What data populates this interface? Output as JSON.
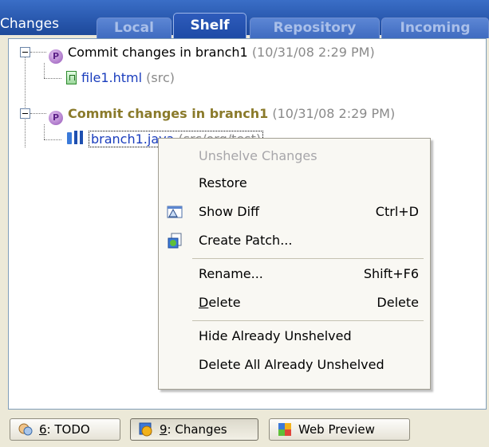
{
  "tabs": {
    "title": "Changes",
    "items": [
      {
        "label": "Local"
      },
      {
        "label": "Shelf"
      },
      {
        "label": "Repository"
      },
      {
        "label": "Incoming"
      }
    ]
  },
  "tree": {
    "list1": {
      "title": "Commit changes in branch1",
      "date": "(10/31/08 2:29 PM)"
    },
    "file1": {
      "name": "file1.html",
      "dir": "(src)"
    },
    "list2": {
      "title": "Commit changes in branch1",
      "date": "(10/31/08 2:29 PM)"
    },
    "file2": {
      "name": "branch1.java",
      "dir": "(src/org/test)"
    }
  },
  "menu": {
    "unshelve": "Unshelve Changes",
    "restore": "Restore",
    "show_diff": "Show Diff",
    "show_diff_key": "Ctrl+D",
    "create_patch": "Create Patch...",
    "rename": "Rename...",
    "rename_key": "Shift+F6",
    "delete_mn": "D",
    "delete_rest": "elete",
    "delete_key": "Delete",
    "hide_unshelved": "Hide Already Unshelved",
    "delete_all_unshelved": "Delete All Already Unshelved"
  },
  "toolbar": {
    "todo_mn": "6",
    "todo_rest": ": TODO",
    "changes_mn": "9",
    "changes_rest": ": Changes",
    "web_preview": "Web Preview"
  },
  "colors": {
    "tab_bar": "#2553a8",
    "selection_text": "#1a3dbd",
    "shelf_date": "#8a8a8a",
    "shelf_title_bold": "#8a7a2a",
    "menu_bg": "#f9f8f3"
  }
}
